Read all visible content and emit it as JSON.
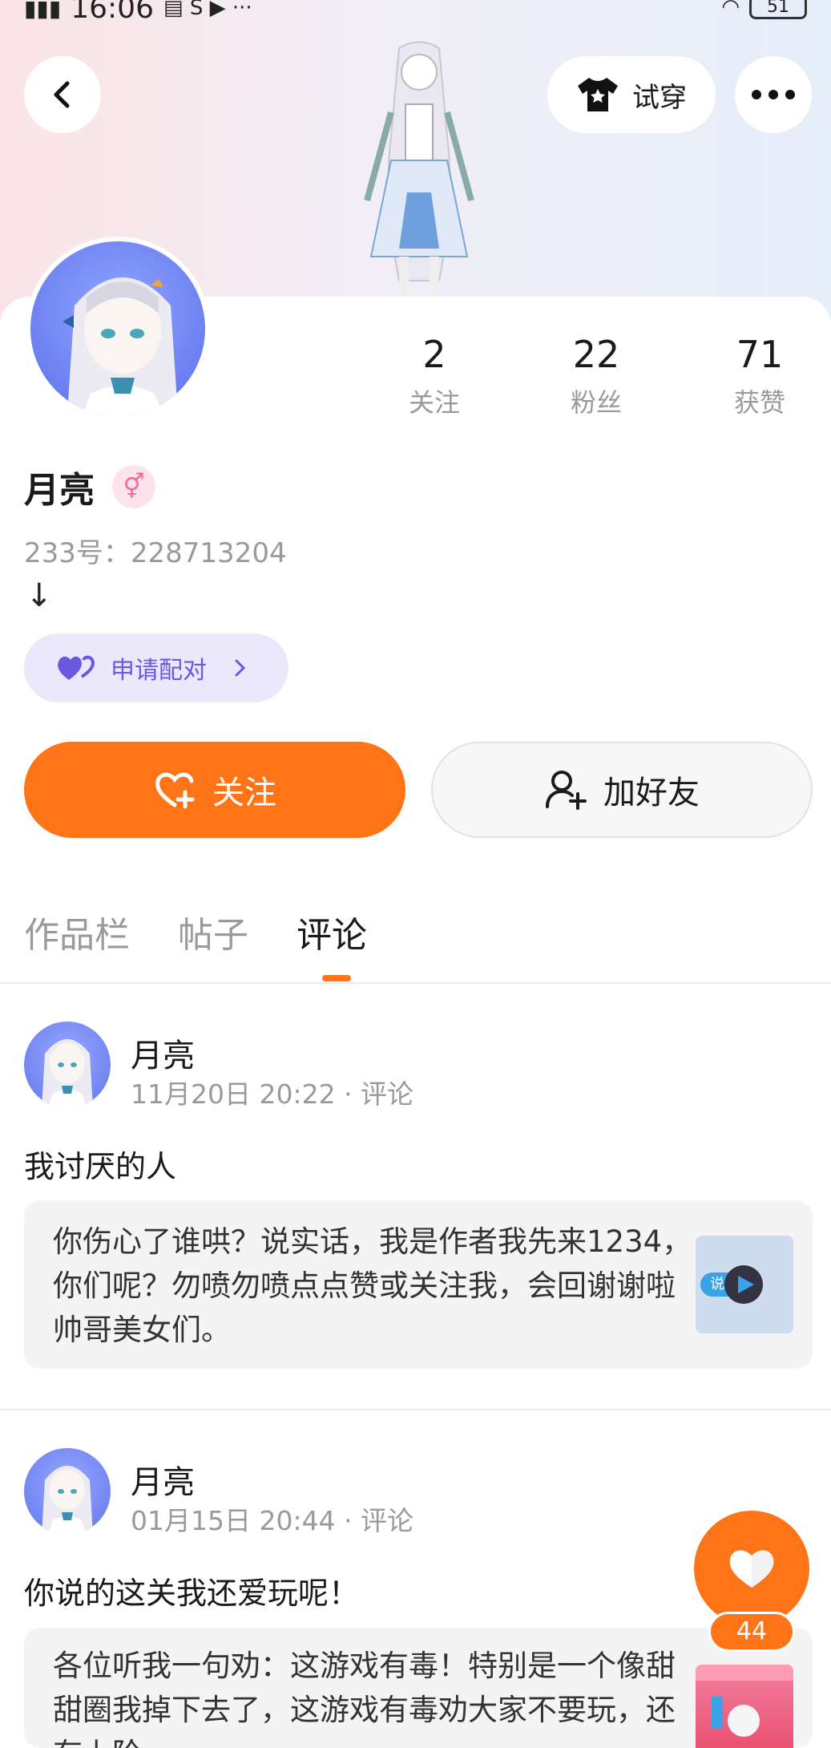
{
  "status_bar": {
    "time": "16:06",
    "battery": "51"
  },
  "header": {
    "try_on_label": "试穿"
  },
  "profile": {
    "stats": [
      {
        "num": "2",
        "label": "关注"
      },
      {
        "num": "22",
        "label": "粉丝"
      },
      {
        "num": "71",
        "label": "获赞"
      }
    ],
    "name": "月亮",
    "gender_symbol": "⚥",
    "uid": "233号：228713204",
    "bio": "↓",
    "pair_label": "申请配对",
    "follow_label": "关注",
    "add_friend_label": "加好友"
  },
  "tabs": [
    "作品栏",
    "帖子",
    "评论"
  ],
  "posts": [
    {
      "author": "月亮",
      "meta": "11月20日 20:22 · 评论",
      "text": "我讨厌的人",
      "quote": "你伤心了谁哄？说实话，我是作者我先来1234，你们呢？勿喷勿喷点点赞或关注我，会回谢谢啦帅哥美女们。",
      "thumb_text": "说实"
    },
    {
      "author": "月亮",
      "meta": "01月15日 20:44 · 评论",
      "text": "你说的这关我还爱玩呢！",
      "quote": "各位听我一句劝：这游戏有毒！特别是一个像甜甜圈我掉下去了，这游戏有毒劝大家不要玩，还有上阶"
    }
  ],
  "fab": {
    "count": "44"
  },
  "colors": {
    "accent": "#ff7417",
    "pair": "#6a58e0"
  }
}
